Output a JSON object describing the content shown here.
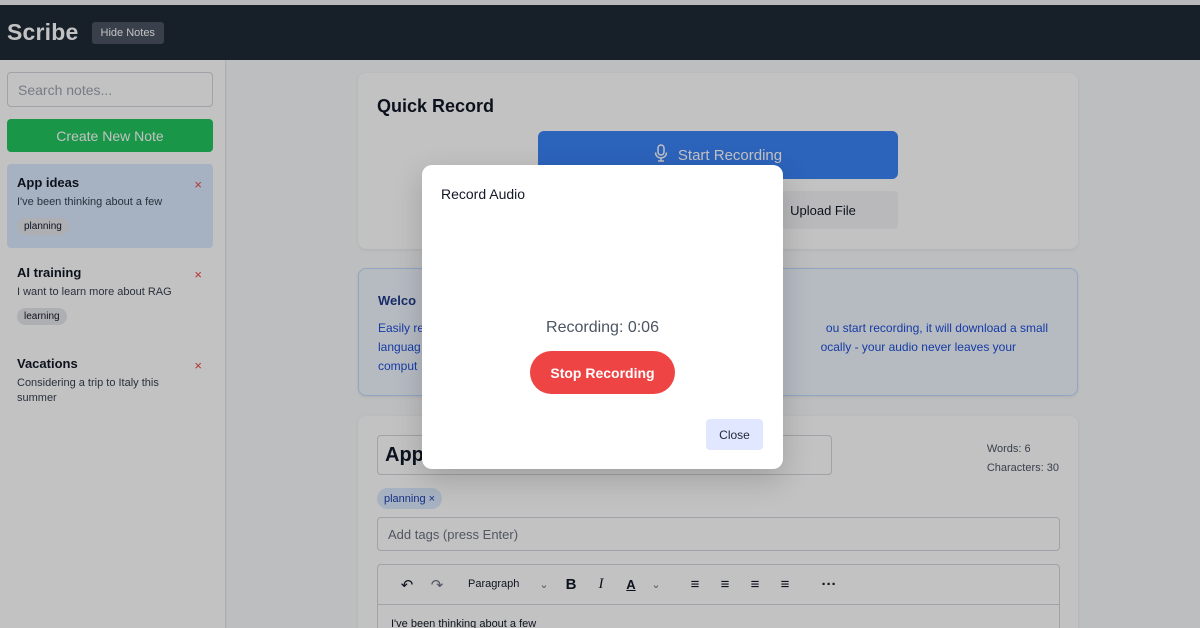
{
  "header": {
    "brand": "Scribe",
    "hide_notes_label": "Hide Notes"
  },
  "sidebar": {
    "search_placeholder": "Search notes...",
    "create_label": "Create New Note",
    "delete_glyph": "×",
    "notes": [
      {
        "title": "App ideas",
        "snippet": "I've been thinking about a few",
        "tag": "planning",
        "active": true
      },
      {
        "title": "AI training",
        "snippet": "I want to learn more about RAG",
        "tag": "learning",
        "active": false
      },
      {
        "title": "Vacations",
        "snippet": "Considering a trip to Italy this summer",
        "tag": "",
        "active": false
      }
    ]
  },
  "quick_record": {
    "title": "Quick Record",
    "start_label": "Start Recording",
    "upload_label": "Upload File"
  },
  "welcome": {
    "title_visible": "Welco",
    "lines": [
      [
        "Easily re",
        "ou start recording, it will download a small"
      ],
      [
        "languag",
        "ocally - your audio never leaves your"
      ],
      [
        "comput",
        ""
      ]
    ]
  },
  "editor": {
    "title_visible": "App",
    "words_label": "Words: 6",
    "chars_label": "Characters: 30",
    "tag": "planning",
    "tag_remove": "×",
    "tags_placeholder": "Add tags (press Enter)",
    "paragraph_select": "Paragraph",
    "body_text": "I've been thinking about a few"
  },
  "modal": {
    "title": "Record Audio",
    "timer_label": "Recording: 0:06",
    "stop_label": "Stop Recording",
    "close_label": "Close"
  },
  "colors": {
    "header_bg": "#1f2937",
    "create_green": "#22c55e",
    "start_blue": "#3b82f6",
    "stop_red": "#ef4444",
    "delete_red": "#ef4444",
    "active_note_bg": "#dbeafe"
  }
}
